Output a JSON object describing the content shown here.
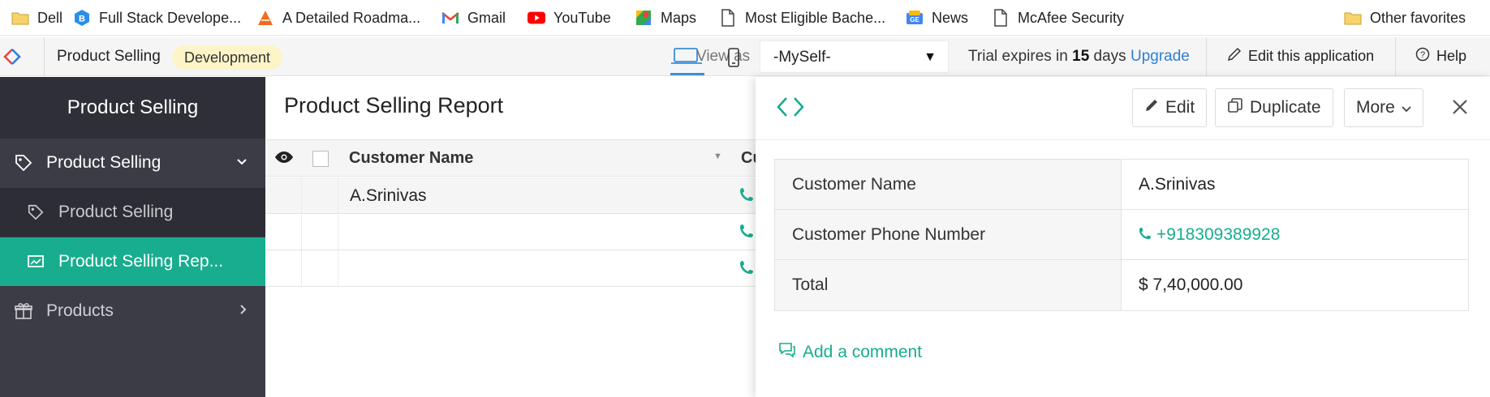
{
  "bookmarks": [
    {
      "label": "Dell",
      "icon": "folder-icon"
    },
    {
      "label": "Full Stack Develope...",
      "icon": "b-logo-icon"
    },
    {
      "label": "A Detailed Roadma...",
      "icon": "roadmap-icon"
    },
    {
      "label": "Gmail",
      "icon": "gmail-icon"
    },
    {
      "label": "YouTube",
      "icon": "youtube-icon"
    },
    {
      "label": "Maps",
      "icon": "maps-icon"
    },
    {
      "label": "Most Eligible Bache...",
      "icon": "page-icon"
    },
    {
      "label": "News",
      "icon": "news-icon"
    },
    {
      "label": "McAfee Security",
      "icon": "page-icon"
    },
    {
      "label": "Other favorites",
      "icon": "folder-icon"
    }
  ],
  "appbar": {
    "app_name": "Product Selling",
    "environment": "Development",
    "view_as_label": "View as",
    "user": "-MySelf-",
    "trial_prefix": "Trial expires in",
    "trial_days": "15",
    "trial_suffix": "days",
    "upgrade": "Upgrade",
    "edit_app": "Edit this application",
    "help": "Help"
  },
  "sidebar": {
    "title": "Product Selling",
    "items": [
      {
        "label": "Product Selling",
        "icon": "tag-icon",
        "expanded": true
      },
      {
        "label": "Product Selling",
        "icon": "tag-icon"
      },
      {
        "label": "Product Selling Rep...",
        "icon": "report-icon",
        "active": true
      },
      {
        "label": "Products",
        "icon": "gift-icon"
      }
    ]
  },
  "report": {
    "title": "Product Selling Report",
    "columns": [
      "Customer Name",
      "Cu"
    ],
    "rows": [
      {
        "name": "A.Srinivas"
      },
      {
        "name": ""
      },
      {
        "name": ""
      }
    ]
  },
  "detail": {
    "buttons": {
      "edit": "Edit",
      "duplicate": "Duplicate",
      "more": "More"
    },
    "fields": [
      {
        "label": "Customer Name",
        "value": "A.Srinivas"
      },
      {
        "label": "Customer Phone Number",
        "value": "+918309389928"
      },
      {
        "label": "Total",
        "value": "$ 7,40,000.00"
      }
    ],
    "add_comment": "Add a comment"
  },
  "colors": {
    "accent": "#17ad8e",
    "sidebar_bg": "#3c3c46",
    "link_blue": "#2f7fd1",
    "badge_bg": "#fdf4c7"
  }
}
